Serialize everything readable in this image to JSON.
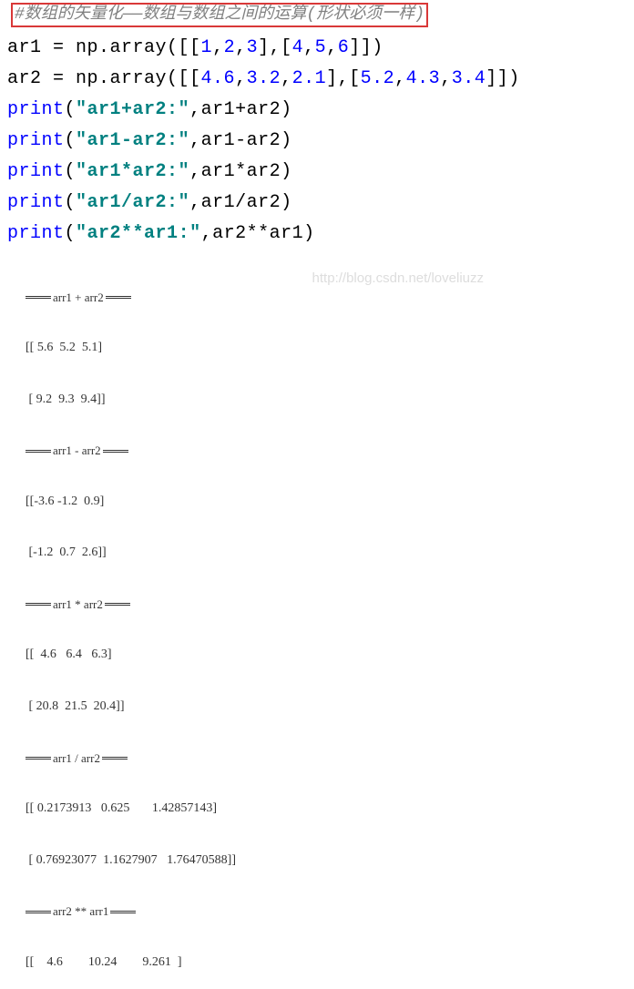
{
  "comment": "#数组的矢量化——数组与数组之间的运算(形状必须一样)",
  "code": {
    "line1_a": "ar1 = np.array([[",
    "line1_nums": [
      "1",
      "2",
      "3"
    ],
    "line1_b": "],[",
    "line1_nums2": [
      "4",
      "5",
      "6"
    ],
    "line1_c": "]])",
    "line2_a": "ar2 = np.array([[",
    "line2_nums": [
      "4.6",
      "3.2",
      "2.1"
    ],
    "line2_b": "],[",
    "line2_nums2": [
      "5.2",
      "4.3",
      "3.4"
    ],
    "line2_c": "]])",
    "print_kw": "print",
    "s1": "ar1+ar2:",
    "e1": "ar1+ar2",
    "s2": "ar1-ar2:",
    "e2": "ar1-ar2",
    "s3": "ar1*ar2:",
    "e3": "ar1*ar2",
    "s4": "ar1/ar2:",
    "e4": "ar1/ar2",
    "s5": "ar2**ar1:",
    "e5": "ar2**ar1"
  },
  "output": {
    "h1": "arr1 + arr2",
    "r1": "[[ 5.6  5.2  5.1]",
    "r2": " [ 9.2  9.3  9.4]]",
    "h2": "arr1 - arr2",
    "r3": "[[-3.6 -1.2  0.9]",
    "r4": " [-1.2  0.7  2.6]]",
    "h3": "arr1 * arr2",
    "r5": "[[  4.6   6.4   6.3]",
    "r6": " [ 20.8  21.5  20.4]]",
    "h4": "arr1 / arr2",
    "r7": "[[ 0.2173913   0.625       1.42857143]",
    "r8": " [ 0.76923077  1.1627907   1.76470588]]",
    "h5": "arr2 ** arr1",
    "r9": "[[    4.6        10.24        9.261  ]"
  },
  "watermark": "http://blog.csdn.net/loveliuzz"
}
